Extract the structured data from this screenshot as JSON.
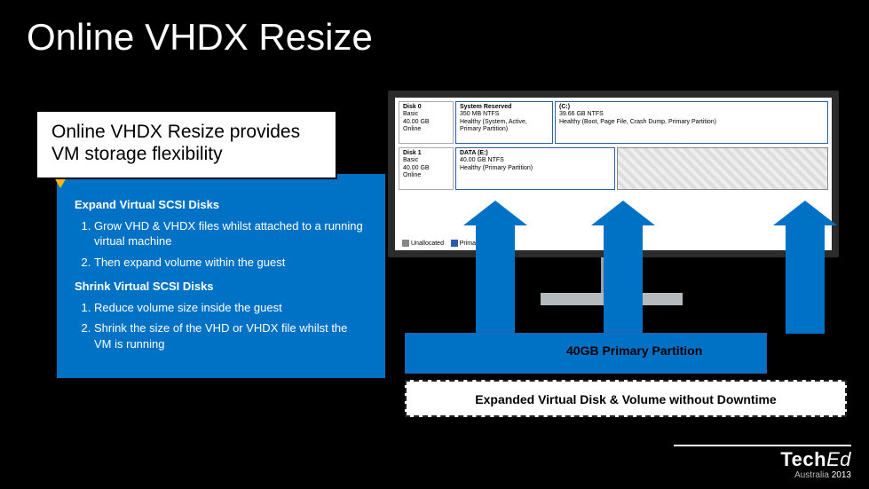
{
  "title": "Online VHDX Resize",
  "subtitle": "Online VHDX Resize provides VM storage flexibility",
  "expand": {
    "heading": "Expand Virtual SCSI Disks",
    "steps": [
      "Grow VHD & VHDX files whilst attached to a running virtual machine",
      "Then expand volume within the guest"
    ]
  },
  "shrink": {
    "heading": "Shrink Virtual SCSI Disks",
    "steps": [
      "Reduce volume size inside the guest",
      "Shrink the size of the VHD or VHDX file whilst the VM is running"
    ]
  },
  "diskmgr": {
    "disk0": {
      "label": "Disk 0",
      "type": "Basic",
      "size": "40.00 GB",
      "state": "Online",
      "p1_name": "System Reserved",
      "p1_size": "350 MB NTFS",
      "p1_status": "Healthy (System, Active, Primary Partition)",
      "p2_name": "(C:)",
      "p2_size": "39.66 GB NTFS",
      "p2_status": "Healthy (Boot, Page File, Crash Dump, Primary Partition)"
    },
    "disk1": {
      "label": "Disk 1",
      "type": "Basic",
      "size": "40.00 GB",
      "state": "Online",
      "p1_name": "DATA (E:)",
      "p1_size": "40.00 GB NTFS",
      "p1_status": "Healthy (Primary Partition)"
    },
    "legend": {
      "unalloc": "Unallocated",
      "primary": "Primary partition"
    }
  },
  "partition_label": "40GB Primary Partition",
  "expanded_label": "Expanded Virtual Disk & Volume without Downtime",
  "footer": {
    "brand_a": "Tech",
    "brand_b": "Ed",
    "loc": "Australia ",
    "year": "2013"
  }
}
